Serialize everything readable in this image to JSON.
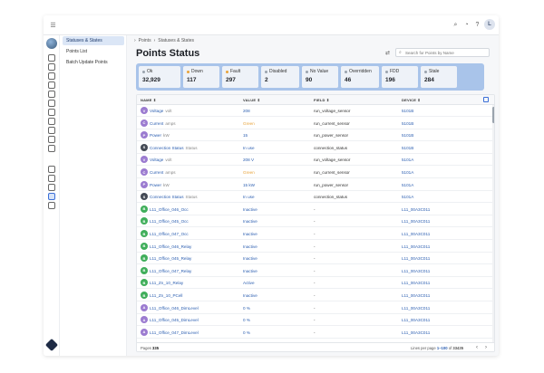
{
  "breadcrumb": [
    "Points",
    "Statuses & States"
  ],
  "page_title": "Points Status",
  "search": {
    "placeholder": "Search for Points by Name"
  },
  "user": {
    "initial": "L"
  },
  "subnav": [
    {
      "label": "Statuses & States",
      "active": true
    },
    {
      "label": "Points List",
      "active": false
    },
    {
      "label": "Batch Update Points",
      "active": false
    }
  ],
  "summary": [
    {
      "label": "Ok",
      "value": "32,929",
      "color": "#9aa3ad"
    },
    {
      "label": "Down",
      "value": "117",
      "color": "#e8a33a"
    },
    {
      "label": "Fault",
      "value": "297",
      "color": "#e8a33a"
    },
    {
      "label": "Disabled",
      "value": "2",
      "color": "#9aa3ad"
    },
    {
      "label": "No Value",
      "value": "90",
      "color": "#9aa3ad"
    },
    {
      "label": "Overridden",
      "value": "46",
      "color": "#9aa3ad"
    },
    {
      "label": "FDD",
      "value": "196",
      "color": "#9aa3ad"
    },
    {
      "label": "Stale",
      "value": "284",
      "color": "#9aa3ad"
    }
  ],
  "table": {
    "headers": [
      "NAME",
      "VALUE",
      "FIELD",
      "DEVICE"
    ],
    "rows": [
      {
        "badge": "V",
        "badge_color": "#9b7bd0",
        "name": "Voltage",
        "unit": "volt",
        "value": "208",
        "value_color": "#2a5db0",
        "field": "run_voltage_sensor",
        "device": "5101B"
      },
      {
        "badge": "C",
        "badge_color": "#9b7bd0",
        "name": "Current",
        "unit": "amps",
        "value": "Green",
        "value_color": "#e8a33a",
        "field": "run_current_sensor",
        "device": "5101B"
      },
      {
        "badge": "P",
        "badge_color": "#9b7bd0",
        "name": "Power",
        "unit": "kW",
        "value": "15",
        "value_color": "#2a5db0",
        "field": "run_power_sensor",
        "device": "5101B"
      },
      {
        "badge": "S",
        "badge_color": "#444a55",
        "name": "Connection Status",
        "unit": "Status",
        "value": "In use",
        "value_color": "#2a5db0",
        "field": "connection_status",
        "device": "5101B"
      },
      {
        "badge": "V",
        "badge_color": "#9b7bd0",
        "name": "Voltage",
        "unit": "volt",
        "value": "208 V",
        "value_color": "#2a5db0",
        "field": "run_voltage_sensor",
        "device": "5101A"
      },
      {
        "badge": "C",
        "badge_color": "#9b7bd0",
        "name": "Current",
        "unit": "amps",
        "value": "Green",
        "value_color": "#e8a33a",
        "field": "run_current_sensor",
        "device": "5101A"
      },
      {
        "badge": "P",
        "badge_color": "#9b7bd0",
        "name": "Power",
        "unit": "kW",
        "value": "15 kW",
        "value_color": "#2a5db0",
        "field": "run_power_sensor",
        "device": "5101A"
      },
      {
        "badge": "S",
        "badge_color": "#444a55",
        "name": "Connection Status",
        "unit": "Status",
        "value": "In use",
        "value_color": "#2a5db0",
        "field": "connection_status",
        "device": "5101A"
      },
      {
        "badge": "B",
        "badge_color": "#3fae5a",
        "name": "L11_Office_046_Occ",
        "unit": "",
        "value": "Inactive",
        "value_color": "#2a5db0",
        "field": "-",
        "device": "L11_00A3C011"
      },
      {
        "badge": "B",
        "badge_color": "#3fae5a",
        "name": "L11_Office_045_Occ",
        "unit": "",
        "value": "Inactive",
        "value_color": "#2a5db0",
        "field": "-",
        "device": "L11_00A3C011"
      },
      {
        "badge": "B",
        "badge_color": "#3fae5a",
        "name": "L11_Office_047_Occ",
        "unit": "",
        "value": "Inactive",
        "value_color": "#2a5db0",
        "field": "-",
        "device": "L11_00A3C011"
      },
      {
        "badge": "B",
        "badge_color": "#3fae5a",
        "name": "L11_Office_046_Relay",
        "unit": "",
        "value": "Inactive",
        "value_color": "#2a5db0",
        "field": "-",
        "device": "L11_00A3C011"
      },
      {
        "badge": "B",
        "badge_color": "#3fae5a",
        "name": "L11_Office_045_Relay",
        "unit": "",
        "value": "Inactive",
        "value_color": "#2a5db0",
        "field": "-",
        "device": "L11_00A3C011"
      },
      {
        "badge": "B",
        "badge_color": "#3fae5a",
        "name": "L11_Office_047_Relay",
        "unit": "",
        "value": "Inactive",
        "value_color": "#2a5db0",
        "field": "-",
        "device": "L11_00A3C011"
      },
      {
        "badge": "B",
        "badge_color": "#3fae5a",
        "name": "L11_Zn_10_Relay",
        "unit": "",
        "value": "Active",
        "value_color": "#2a5db0",
        "field": "-",
        "device": "L11_00A3C011"
      },
      {
        "badge": "B",
        "badge_color": "#3fae5a",
        "name": "L11_Zn_10_PCell",
        "unit": "",
        "value": "Inactive",
        "value_color": "#2a5db0",
        "field": "-",
        "device": "L11_00A3C011"
      },
      {
        "badge": "A",
        "badge_color": "#9b7bd0",
        "name": "L11_Office_046_DimLevel",
        "unit": "",
        "value": "0 %",
        "value_color": "#2a5db0",
        "field": "-",
        "device": "L11_00A3C011"
      },
      {
        "badge": "A",
        "badge_color": "#9b7bd0",
        "name": "L11_Office_045_DimLevel",
        "unit": "",
        "value": "0 %",
        "value_color": "#2a5db0",
        "field": "-",
        "device": "L11_00A3C011"
      },
      {
        "badge": "A",
        "badge_color": "#9b7bd0",
        "name": "L11_Office_047_DimLevel",
        "unit": "",
        "value": "0 %",
        "value_color": "#2a5db0",
        "field": "-",
        "device": "L11_00A3C011"
      }
    ]
  },
  "footer": {
    "pages_label": "Pages",
    "pages_count": "335",
    "lines_label": "Lines per page",
    "range": "1–100",
    "of_label": "of",
    "total": "33435"
  }
}
